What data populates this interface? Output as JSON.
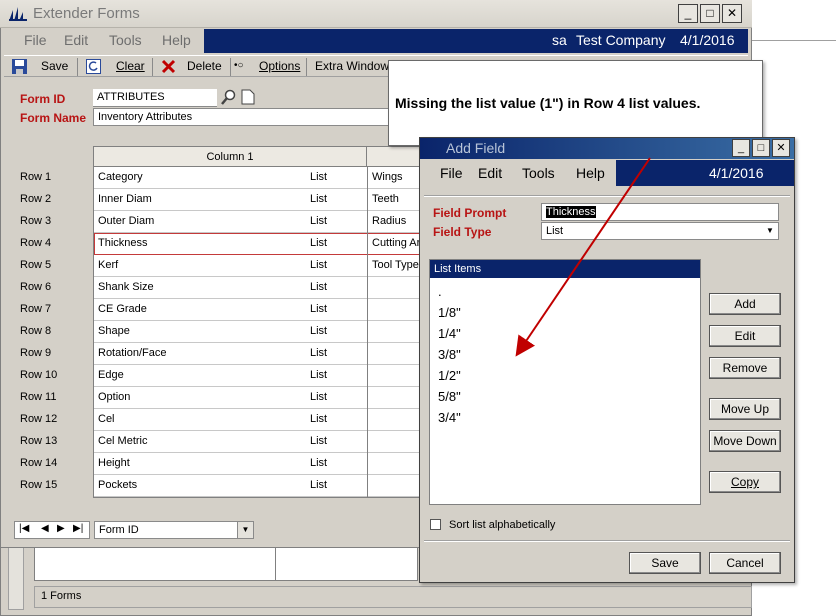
{
  "background_window": {
    "status_text": "1 Forms"
  },
  "main_window": {
    "title": "Extender Forms",
    "title_buttons": {
      "minimize": "_",
      "maximize": "□",
      "close": "✕"
    },
    "menu": [
      "File",
      "Edit",
      "Tools",
      "Help"
    ],
    "user": "sa",
    "company": "Test Company",
    "date": "4/1/2016",
    "toolbar": {
      "save": "Save",
      "clear": "Clear",
      "delete": "Delete",
      "options_marker": "•○",
      "options": "Options",
      "extra_windows": "Extra Windows"
    },
    "form_id_label": "Form ID",
    "form_id_value": "ATTRIBUTES",
    "form_name_label": "Form Name",
    "form_name_value": "Inventory Attributes",
    "grid": {
      "column1_header": "Column 1",
      "rows": [
        {
          "label": "Row 1",
          "name": "Category",
          "type": "List",
          "next": "Wings"
        },
        {
          "label": "Row 2",
          "name": "Inner Diam",
          "type": "List",
          "next": "Teeth"
        },
        {
          "label": "Row 3",
          "name": "Outer Diam",
          "type": "List",
          "next": "Radius"
        },
        {
          "label": "Row 4",
          "name": "Thickness",
          "type": "List",
          "next": "Cutting Ar"
        },
        {
          "label": "Row 5",
          "name": "Kerf",
          "type": "List",
          "next": "Tool Type"
        },
        {
          "label": "Row 6",
          "name": "Shank Size",
          "type": "List",
          "next": ""
        },
        {
          "label": "Row 7",
          "name": "CE Grade",
          "type": "List",
          "next": ""
        },
        {
          "label": "Row 8",
          "name": "Shape",
          "type": "List",
          "next": ""
        },
        {
          "label": "Row 9",
          "name": "Rotation/Face",
          "type": "List",
          "next": ""
        },
        {
          "label": "Row 10",
          "name": "Edge",
          "type": "List",
          "next": ""
        },
        {
          "label": "Row 11",
          "name": "Option",
          "type": "List",
          "next": ""
        },
        {
          "label": "Row 12",
          "name": "Cel",
          "type": "List",
          "next": ""
        },
        {
          "label": "Row 13",
          "name": "Cel Metric",
          "type": "List",
          "next": ""
        },
        {
          "label": "Row 14",
          "name": "Height",
          "type": "List",
          "next": ""
        },
        {
          "label": "Row 15",
          "name": "Pockets",
          "type": "List",
          "next": ""
        }
      ]
    },
    "nav": {
      "first": "|◀",
      "prev": "◀",
      "next": "▶",
      "last": "▶|",
      "sort_by": "Form ID"
    }
  },
  "dialog": {
    "title": "Add Field",
    "menu": [
      "File",
      "Edit",
      "Tools",
      "Help"
    ],
    "date": "4/1/2016",
    "field_prompt_label": "Field Prompt",
    "field_prompt_value": "Thickness",
    "field_type_label": "Field Type",
    "field_type_value": "List",
    "list_items_header": "List Items",
    "list_items": [
      ".",
      "1/8\"",
      "1/4\"",
      "3/8\"",
      "1/2\"",
      "5/8\"",
      "3/4\""
    ],
    "buttons": {
      "add": "Add",
      "edit": "Edit",
      "remove": "Remove",
      "move_up": "Move Up",
      "move_down": "Move Down",
      "copy": "Copy",
      "save": "Save",
      "cancel": "Cancel"
    },
    "sort_label": "Sort list alphabetically"
  },
  "callout": {
    "text": "Missing the list value (1\") in Row 4 list values."
  },
  "colors": {
    "navy": "#0a246a",
    "label_red": "#b81414",
    "arrow_red": "#c00000",
    "window_gray": "#d4d0c8"
  }
}
